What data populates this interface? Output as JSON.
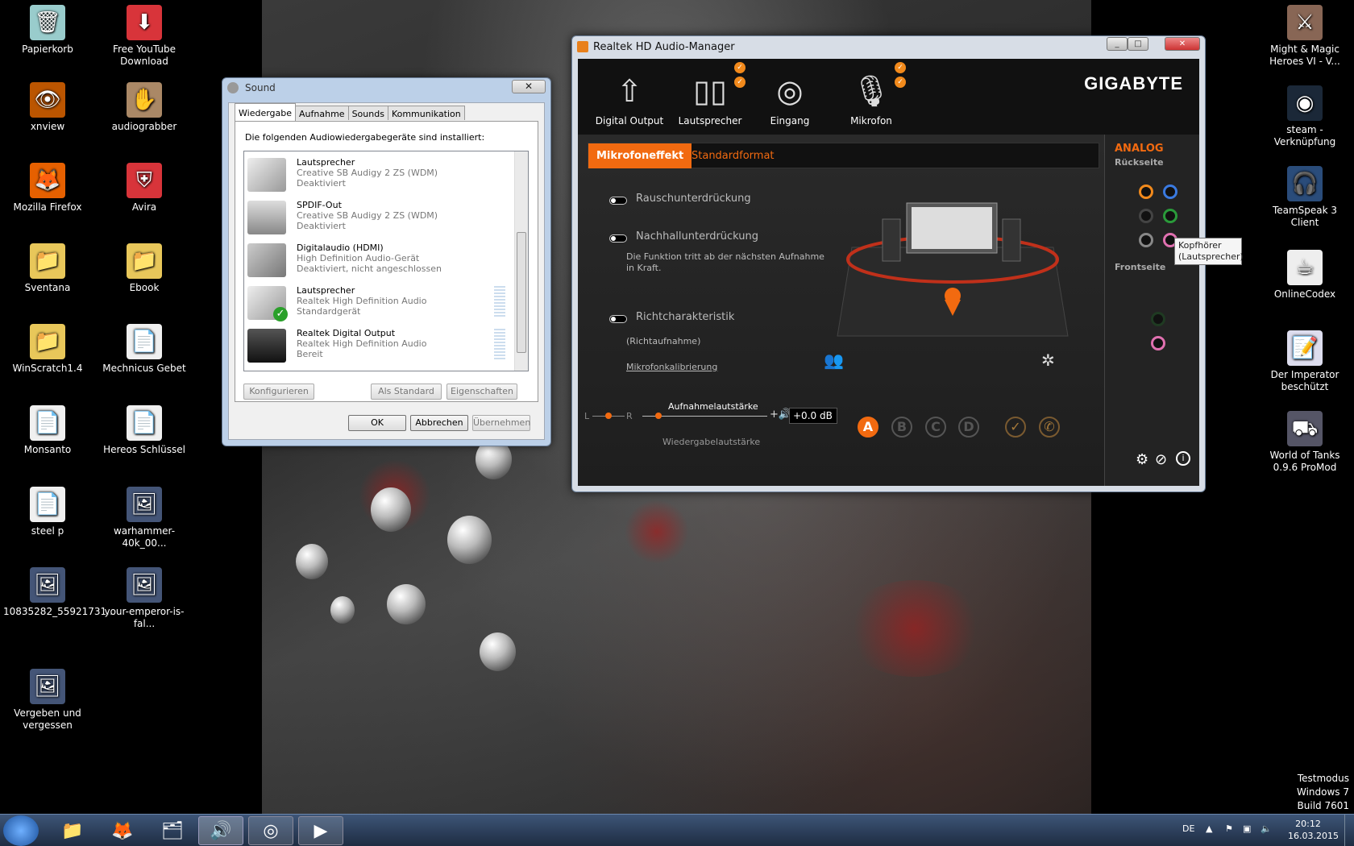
{
  "desktop": {
    "left_icons": [
      {
        "label": "Papierkorb",
        "icon": "recycle-bin-icon"
      },
      {
        "label": "Free YouTube Download",
        "icon": "download-arrow-icon"
      },
      {
        "label": "xnview",
        "icon": "eye-icon"
      },
      {
        "label": "audiograbber",
        "icon": "hand-icon"
      },
      {
        "label": "Mozilla Firefox",
        "icon": "firefox-icon"
      },
      {
        "label": "Avira",
        "icon": "avira-icon"
      },
      {
        "label": "Sventana",
        "icon": "folder-icon"
      },
      {
        "label": "Ebook",
        "icon": "folder-icon"
      },
      {
        "label": "WinScratch1.4",
        "icon": "folder-icon"
      },
      {
        "label": "Mechnicus Gebet",
        "icon": "document-icon"
      },
      {
        "label": "Monsanto",
        "icon": "document-icon"
      },
      {
        "label": "Hereos Schlüssel",
        "icon": "document-icon"
      },
      {
        "label": "steel p",
        "icon": "document-icon"
      },
      {
        "label": "warhammer-40k_00...",
        "icon": "image-icon"
      },
      {
        "label": "10835282_55921731...",
        "icon": "image-icon"
      },
      {
        "label": "your-emperor-is-fal...",
        "icon": "image-icon"
      },
      {
        "label": "Vergeben und vergessen",
        "icon": "image-icon"
      }
    ],
    "right_icons": [
      {
        "label": "Might & Magic Heroes VI - V...",
        "icon": "game-icon"
      },
      {
        "label": "steam - Verknüpfung",
        "icon": "steam-icon"
      },
      {
        "label": "TeamSpeak 3 Client",
        "icon": "teamspeak-icon"
      },
      {
        "label": "OnlineCodex",
        "icon": "java-icon"
      },
      {
        "label": "Der Imperator beschützt",
        "icon": "word-doc-icon"
      },
      {
        "label": "World of Tanks 0.9.6 ProMod",
        "icon": "tank-icon"
      }
    ],
    "watermark": [
      "Testmodus",
      "Windows 7",
      "Build 7601"
    ]
  },
  "sound": {
    "title": "Sound",
    "close": "✕",
    "tabs": [
      "Wiedergabe",
      "Aufnahme",
      "Sounds",
      "Kommunikation"
    ],
    "hint": "Die folgenden Audiowiedergabegeräte sind installiert:",
    "devices": [
      {
        "name": "Lautsprecher",
        "desc": "Creative SB Audigy 2 ZS (WDM)",
        "status": "Deaktiviert"
      },
      {
        "name": "SPDIF-Out",
        "desc": "Creative SB Audigy 2 ZS (WDM)",
        "status": "Deaktiviert"
      },
      {
        "name": "Digitalaudio (HDMI)",
        "desc": "High Definition Audio-Gerät",
        "status": "Deaktiviert, nicht angeschlossen"
      },
      {
        "name": "Lautsprecher",
        "desc": "Realtek High Definition Audio",
        "status": "Standardgerät"
      },
      {
        "name": "Realtek Digital Output",
        "desc": "Realtek High Definition Audio",
        "status": "Bereit"
      }
    ],
    "buttons": {
      "configure": "Konfigurieren",
      "default": "Als Standard",
      "properties": "Eigenschaften",
      "ok": "OK",
      "cancel": "Abbrechen",
      "apply": "Übernehmen"
    }
  },
  "realtek": {
    "title": "Realtek HD Audio-Manager",
    "nav": [
      "Digital Output",
      "Lautsprecher",
      "Eingang",
      "Mikrofon"
    ],
    "brand": "GIGABYTE",
    "tabs": [
      "Mikrofoneffekt",
      "Standardformat"
    ],
    "options": {
      "noise": "Rauschunterdrückung",
      "echo": "Nachhallunterdrückung",
      "echo_note": "Die Funktion tritt ab der nächsten Aufnahme in Kraft.",
      "beam": "Richtcharakteristik",
      "beam_sub": "(Richtaufnahme)",
      "calib": "Mikrofonkalibrierung"
    },
    "volume": {
      "rec_label": "Aufnahmelautstärke",
      "play_label": "Wiedergabelautstärke",
      "db": "+0.0 dB",
      "l": "L",
      "r": "R"
    },
    "profiles": [
      "A",
      "B",
      "C",
      "D"
    ],
    "side": {
      "analog": "ANALOG",
      "back": "Rückseite",
      "front": "Frontseite"
    },
    "tooltip": [
      "Kopfhörer",
      "(Lautsprecher)"
    ]
  },
  "taskbar": {
    "lang": "DE",
    "time": "20:12",
    "date": "16.03.2015"
  }
}
